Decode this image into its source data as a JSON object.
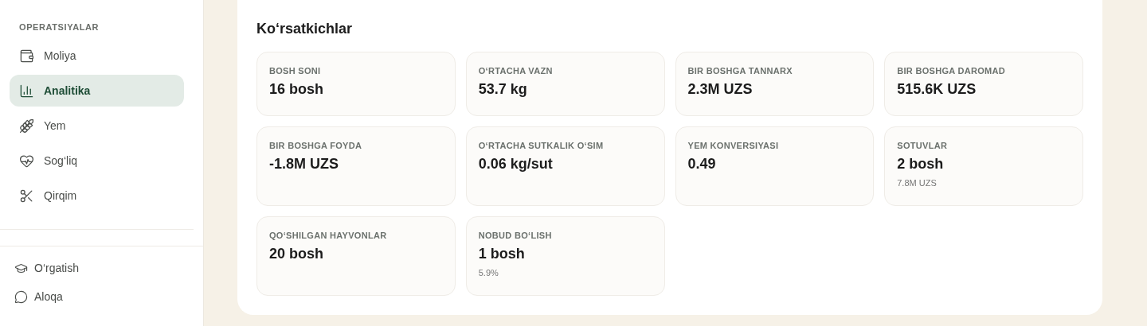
{
  "sidebar": {
    "section_title": "OPERATSIYALAR",
    "items": [
      {
        "label": "Moliya",
        "selected": false
      },
      {
        "label": "Analitika",
        "selected": true
      },
      {
        "label": "Yem",
        "selected": false
      },
      {
        "label": "Sog‘liq",
        "selected": false
      },
      {
        "label": "Qirqim",
        "selected": false
      }
    ],
    "footer_items": [
      {
        "label": "O‘rgatish"
      },
      {
        "label": "Aloqa"
      }
    ]
  },
  "panel": {
    "title": "Koʻrsatkichlar",
    "metrics": [
      {
        "label": "BOSH SONI",
        "value": "16 bosh"
      },
      {
        "label": "O‘RTACHA VAZN",
        "value": "53.7 kg"
      },
      {
        "label": "BIR BOSHGA TANNARX",
        "value": "2.3M UZS"
      },
      {
        "label": "BIR BOSHGA DAROMAD",
        "value": "515.6K UZS"
      },
      {
        "label": "BIR BOSHGA FOYDA",
        "value": "-1.8M UZS"
      },
      {
        "label": "O‘RTACHA SUTKALIK O‘SIM",
        "value": "0.06 kg/sut"
      },
      {
        "label": "YEM KONVERSIYASI",
        "value": "0.49"
      },
      {
        "label": "SOTUVLAR",
        "value": "2 bosh",
        "sub": "7.8M UZS"
      },
      {
        "label": "QO‘SHILGAN HAYVONLAR",
        "value": "20 bosh"
      },
      {
        "label": "NOBUD BO‘LISH",
        "value": "1 bosh",
        "sub": "5.9%"
      }
    ]
  }
}
